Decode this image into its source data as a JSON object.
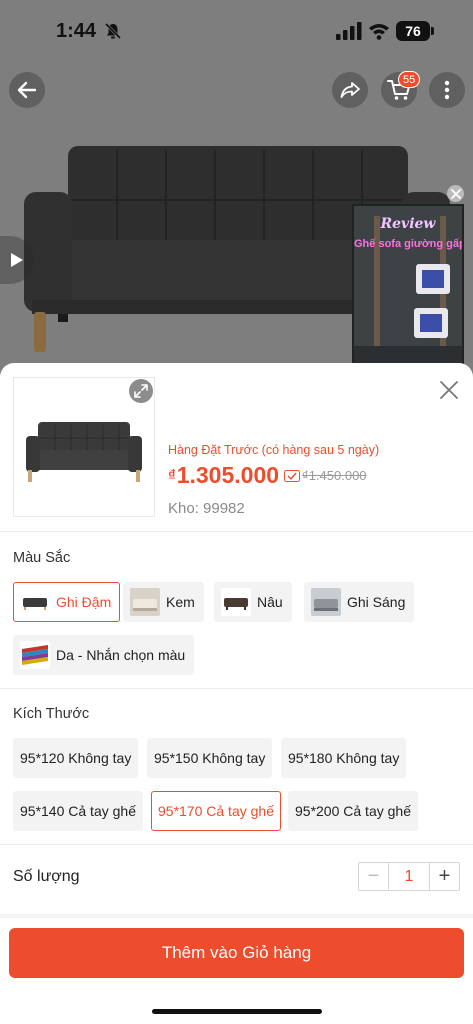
{
  "status_bar": {
    "time": "1:44",
    "battery": "76"
  },
  "header": {
    "cart_count": "55"
  },
  "review_thumb": {
    "title": "Review",
    "subtitle": "Ghế sofa giường gấp gọn"
  },
  "sheet": {
    "preorder_note": "Hàng Đặt Trước (có hàng sau 5 ngày)",
    "currency": "₫",
    "price": "1.305.000",
    "old_price": "₫1.450.000",
    "stock": "Kho: 99982"
  },
  "color_section": {
    "title": "Màu Sắc",
    "options": [
      {
        "label": "Ghi Đậm",
        "selected": true
      },
      {
        "label": "Kem",
        "selected": false
      },
      {
        "label": "Nâu",
        "selected": false
      },
      {
        "label": "Ghi Sáng",
        "selected": false
      },
      {
        "label": "Da -  Nhắn chọn màu",
        "selected": false
      }
    ]
  },
  "size_section": {
    "title": "Kích Thước",
    "options": [
      {
        "label": "95*120 Không tay",
        "selected": false
      },
      {
        "label": "95*150 Không tay",
        "selected": false
      },
      {
        "label": "95*180 Không tay",
        "selected": false
      },
      {
        "label": "95*140 Cả tay ghế",
        "selected": false
      },
      {
        "label": "95*170 Cả tay ghế",
        "selected": true
      },
      {
        "label": "95*200 Cả tay ghế",
        "selected": false
      }
    ]
  },
  "quantity": {
    "label": "Số lượng",
    "value": "1",
    "minus": "−",
    "plus": "+"
  },
  "cta": {
    "add_to_cart": "Thêm vào Giỏ hàng"
  },
  "colors": {
    "accent": "#ee4d2d",
    "chip_bg": "#f3f3f3"
  }
}
